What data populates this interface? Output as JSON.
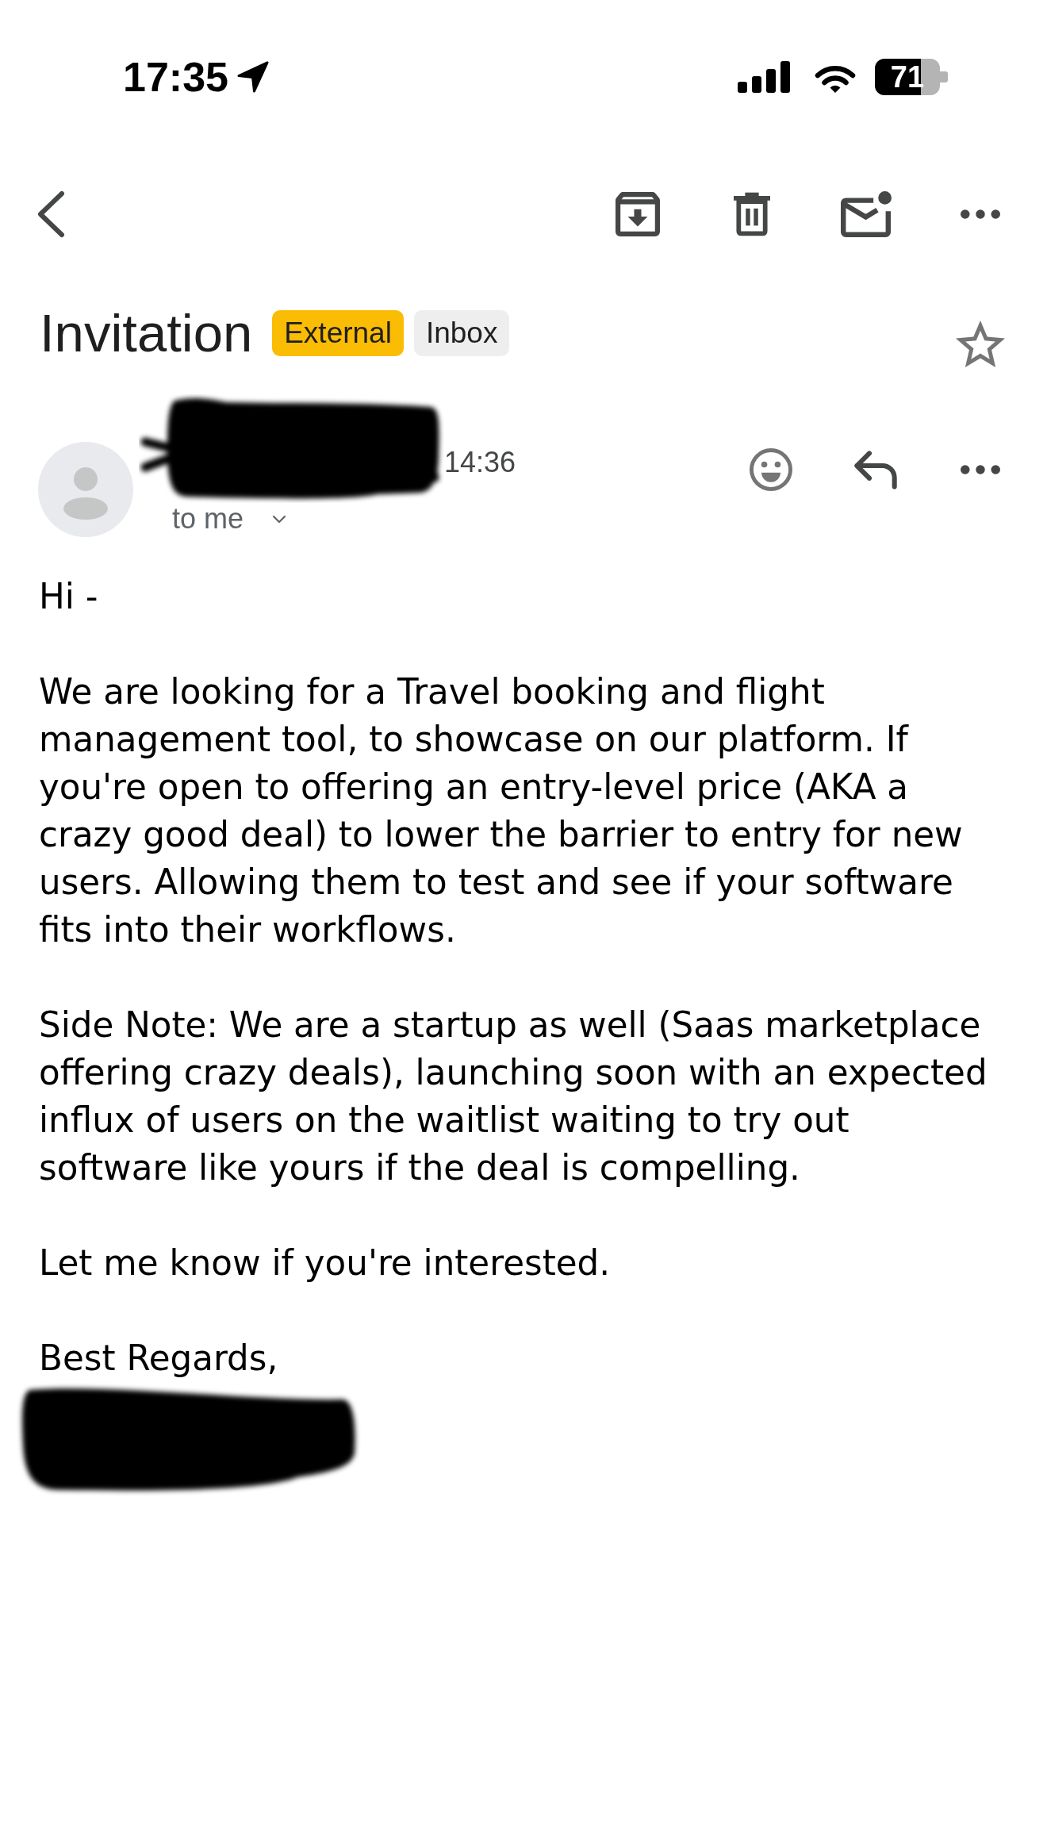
{
  "status_bar": {
    "time": "17:35",
    "battery": "71"
  },
  "message": {
    "subject": "Invitation",
    "labels": [
      {
        "text": "External",
        "color": "#fbbc04"
      },
      {
        "text": "Inbox",
        "color": "#eeeeee"
      }
    ],
    "starred": false,
    "sender": {
      "time": "14:36",
      "recipient": "to me"
    },
    "body": [
      "Hi -",
      "We are looking for a Travel booking and flight management tool, to showcase on our platform. If you're open to offering an entry-level price (AKA a crazy good deal) to lower the barrier to entry for new users. Allowing them to test and see if your software fits into their workflows.",
      "Side Note: We are a startup as well (Saas marketplace offering crazy deals), launching soon with an expected influx of users on the waitlist waiting to try out software like yours if the deal is compelling.",
      "Let me know if you're interested.",
      "Best Regards,"
    ]
  }
}
